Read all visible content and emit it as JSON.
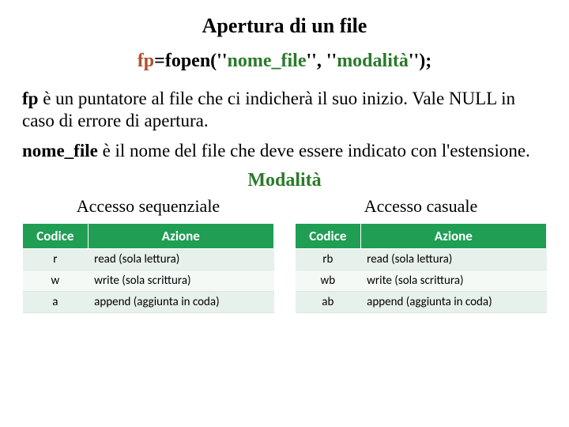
{
  "title": "Apertura di un file",
  "syntax": {
    "fp": "fp",
    "eq": "=fopen(",
    "q1": "''",
    "nome": "nome_file",
    "q2": "''",
    "sep": ", ",
    "q3": "''",
    "modalita": "modalità",
    "q4": "''",
    "end": ");"
  },
  "para1": {
    "kw": "fp",
    "rest": " è un puntatore al file che ci indicherà il suo inizio. Vale NULL in caso di errore di apertura."
  },
  "para2": {
    "kw": "nome_file",
    "rest": " è il nome del file che deve essere indicato con l'estensione."
  },
  "modalita_heading": "Modalità",
  "tables": {
    "left": {
      "caption": "Accesso sequenziale",
      "h1": "Codice",
      "h2": "Azione",
      "rows": [
        {
          "code": "r",
          "action": "read (sola lettura)"
        },
        {
          "code": "w",
          "action": "write (sola scrittura)"
        },
        {
          "code": "a",
          "action": "append (aggiunta in coda)"
        }
      ]
    },
    "right": {
      "caption": "Accesso casuale",
      "h1": "Codice",
      "h2": "Azione",
      "rows": [
        {
          "code": "rb",
          "action": "read (sola lettura)"
        },
        {
          "code": "wb",
          "action": "write (sola  scrittura)"
        },
        {
          "code": "ab",
          "action": "append (aggiunta in coda)"
        }
      ]
    }
  }
}
